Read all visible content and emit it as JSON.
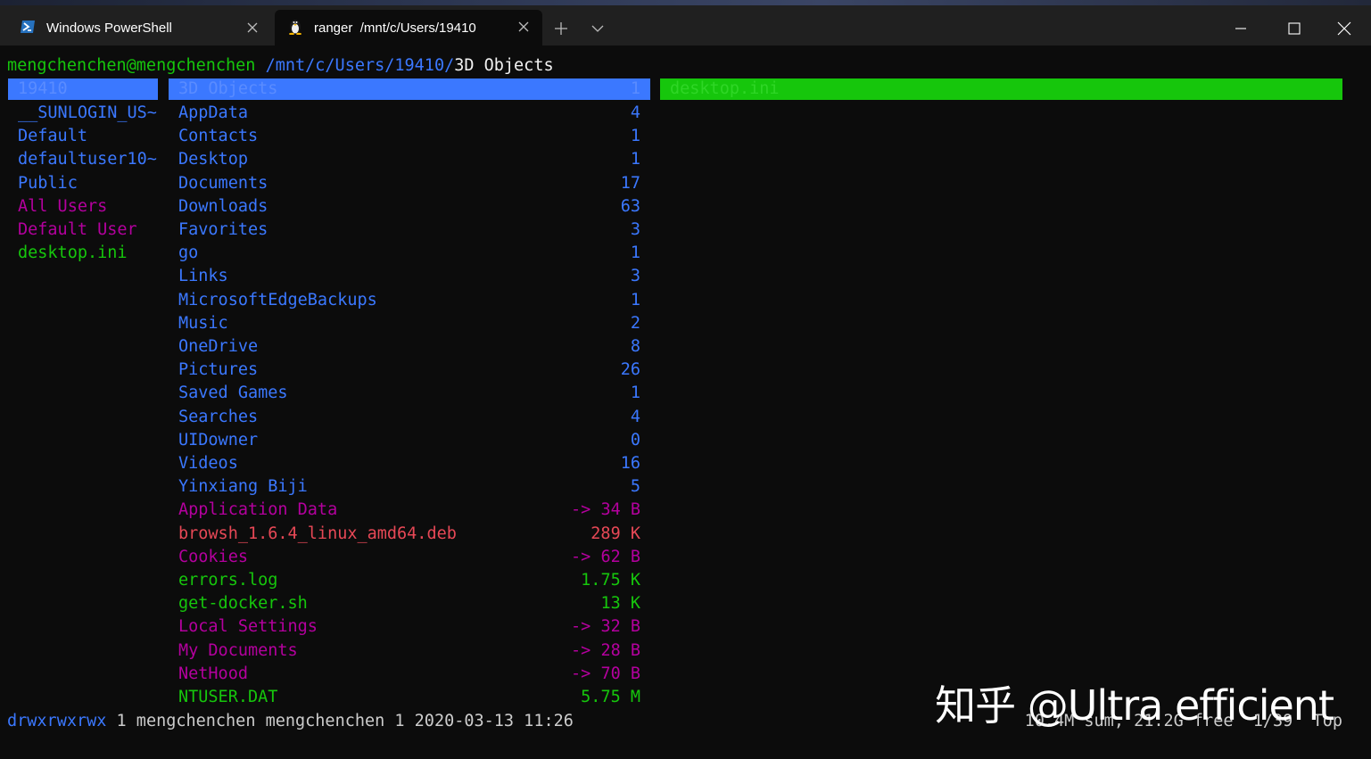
{
  "window": {
    "tabs": [
      {
        "title": "Windows PowerShell",
        "icon": "powershell-icon",
        "active": false
      },
      {
        "title": "ranger  /mnt/c/Users/19410",
        "icon": "linux-penguin-icon",
        "active": true
      }
    ],
    "new_tab_icon": "plus-icon",
    "dropdown_icon": "chevron-down-icon",
    "controls": [
      "minimize-icon",
      "maximize-icon",
      "close-icon"
    ]
  },
  "prompt": {
    "user_host": "mengchenchen@mengchenchen",
    "path": "/mnt/c/Users/19410/",
    "current": "3D Objects"
  },
  "parent_column": {
    "selected": "19410",
    "items": [
      {
        "name": "__SUNLOGIN_US~",
        "color": "blue"
      },
      {
        "name": "Default",
        "color": "blue"
      },
      {
        "name": "defaultuser10~",
        "color": "blue"
      },
      {
        "name": "Public",
        "color": "blue"
      },
      {
        "name": "All Users",
        "color": "magenta"
      },
      {
        "name": "Default User",
        "color": "magenta"
      },
      {
        "name": "desktop.ini",
        "color": "green"
      }
    ]
  },
  "main_column": {
    "selected": {
      "name": "3D Objects",
      "size": "1"
    },
    "items": [
      {
        "name": "AppData",
        "size": "4",
        "color": "blue"
      },
      {
        "name": "Contacts",
        "size": "1",
        "color": "blue"
      },
      {
        "name": "Desktop",
        "size": "1",
        "color": "blue"
      },
      {
        "name": "Documents",
        "size": "17",
        "color": "blue"
      },
      {
        "name": "Downloads",
        "size": "63",
        "color": "blue"
      },
      {
        "name": "Favorites",
        "size": "3",
        "color": "blue"
      },
      {
        "name": "go",
        "size": "1",
        "color": "blue"
      },
      {
        "name": "Links",
        "size": "3",
        "color": "blue"
      },
      {
        "name": "MicrosoftEdgeBackups",
        "size": "1",
        "color": "blue"
      },
      {
        "name": "Music",
        "size": "2",
        "color": "blue"
      },
      {
        "name": "OneDrive",
        "size": "8",
        "color": "blue"
      },
      {
        "name": "Pictures",
        "size": "26",
        "color": "blue"
      },
      {
        "name": "Saved Games",
        "size": "1",
        "color": "blue"
      },
      {
        "name": "Searches",
        "size": "4",
        "color": "blue"
      },
      {
        "name": "UIDowner",
        "size": "0",
        "color": "blue"
      },
      {
        "name": "Videos",
        "size": "16",
        "color": "blue"
      },
      {
        "name": "Yinxiang Biji",
        "size": "5",
        "color": "blue"
      },
      {
        "name": "Application Data",
        "size": "-> 34 B",
        "color": "magenta"
      },
      {
        "name": "browsh_1.6.4_linux_amd64.deb",
        "size": "289 K",
        "color": "red"
      },
      {
        "name": "Cookies",
        "size": "-> 62 B",
        "color": "magenta"
      },
      {
        "name": "errors.log",
        "size": "1.75 K",
        "color": "green"
      },
      {
        "name": "get-docker.sh",
        "size": "13 K",
        "color": "green"
      },
      {
        "name": "Local Settings",
        "size": "-> 32 B",
        "color": "magenta"
      },
      {
        "name": "My Documents",
        "size": "-> 28 B",
        "color": "magenta"
      },
      {
        "name": "NetHood",
        "size": "-> 70 B",
        "color": "magenta"
      },
      {
        "name": "NTUSER.DAT",
        "size": "5.75 M",
        "color": "green"
      }
    ]
  },
  "preview_column": {
    "selected": "desktop.ini"
  },
  "status": {
    "permissions": "drwxrwxrwx",
    "info": " 1 mengchenchen mengchenchen 1 2020-03-13 11:26",
    "right": "10.4M sum, 21.2G free  1/39  Top"
  },
  "watermark": "知乎 @Ultra efficient",
  "colors": {
    "blue": "#3b78ff",
    "magenta": "#b4009e",
    "green": "#16c60c",
    "red": "#e74856",
    "selection_blue": "#3b78ff",
    "selection_green": "#16c60c"
  }
}
